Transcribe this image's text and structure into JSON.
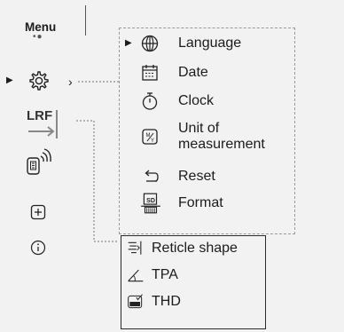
{
  "menu": {
    "title": "Menu",
    "dots": "•●"
  },
  "sidebar": {
    "items": [
      {
        "name": "settings-gear-icon",
        "selected": true
      },
      {
        "name": "lrf-icon",
        "label": "LRF"
      },
      {
        "name": "remote-control-icon"
      },
      {
        "name": "add-icon"
      },
      {
        "name": "info-icon"
      }
    ]
  },
  "settings_submenu": {
    "items": [
      {
        "label": "Language",
        "icon": "globe-icon",
        "selected": true
      },
      {
        "label": "Date",
        "icon": "calendar-icon"
      },
      {
        "label": "Clock",
        "icon": "stopwatch-icon"
      },
      {
        "label_line1": "Unit of",
        "label_line2": "measurement",
        "icon": "unit-conversion-icon"
      },
      {
        "label": "Reset",
        "icon": "return-arrow-icon"
      },
      {
        "label": "Format",
        "icon": "sd-card-format-icon"
      }
    ]
  },
  "lrf_submenu": {
    "items": [
      {
        "label": "Reticle shape",
        "icon": "reticle-list-icon"
      },
      {
        "label": "TPA",
        "icon": "angle-icon"
      },
      {
        "label": "THD",
        "icon": "thd-icon",
        "icon_text": "THD"
      }
    ]
  }
}
